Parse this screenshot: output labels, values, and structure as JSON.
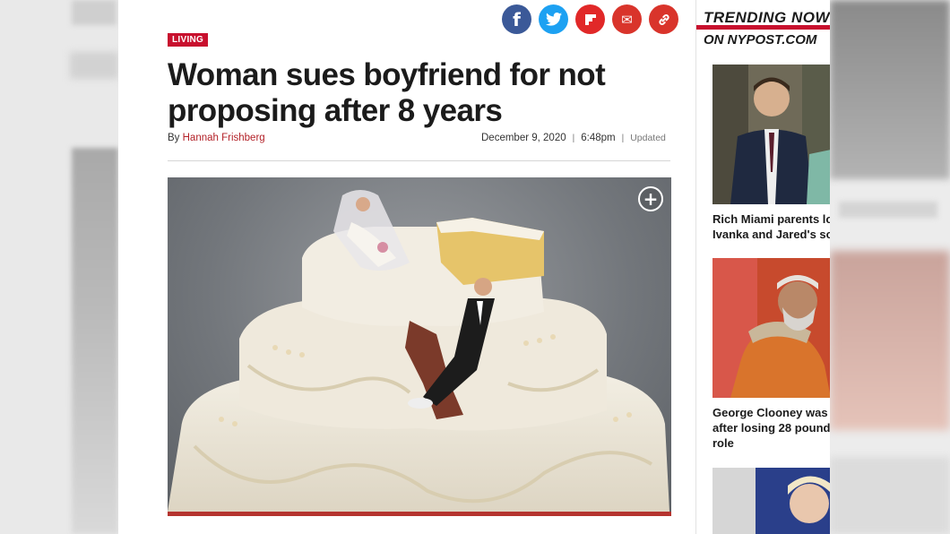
{
  "share": {
    "facebook_icon": "f",
    "twitter_icon": "t",
    "flipboard_icon": "F",
    "email_icon": "✉",
    "link_icon": "🔗"
  },
  "article": {
    "section_tag": "LIVING",
    "headline": "Woman sues boyfriend for not proposing after 8 years",
    "by_label": "By",
    "author": "Hannah Frishberg",
    "date": "December 9, 2020",
    "time": "6:48pm",
    "separator": "|",
    "updated_label": "Updated",
    "expand_icon": "+"
  },
  "sidebar": {
    "trending_line1": "TRENDING NOW",
    "trending_line2": "ON NYPOST.COM",
    "items": [
      {
        "title_line1": "Rich Miami parents lo",
        "title_line2": "Ivanka and Jared's sc"
      },
      {
        "title_line1": "George Clooney was",
        "title_line2": "after losing 28 pound",
        "title_line3": "role"
      }
    ]
  },
  "colors": {
    "accent_red": "#c8102e",
    "facebook": "#3b5998",
    "twitter": "#1da1f2"
  }
}
